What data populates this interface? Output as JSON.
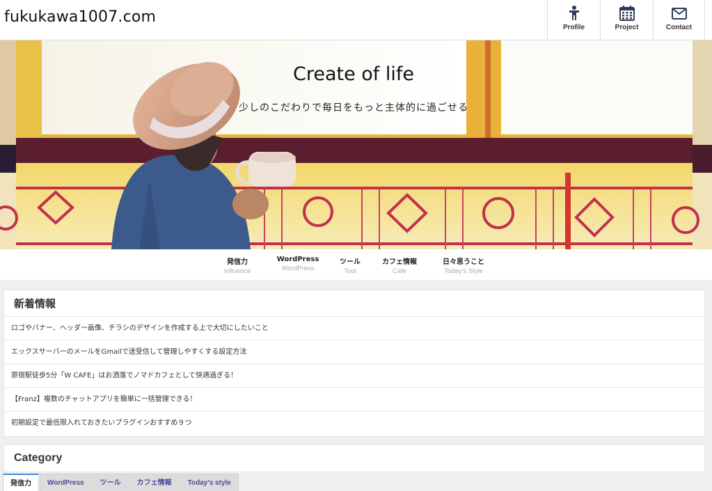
{
  "header": {
    "site_title": "fukukawa1007.com",
    "nav": [
      {
        "label": "Profile",
        "icon": "person-icon"
      },
      {
        "label": "Project",
        "icon": "calendar-icon"
      },
      {
        "label": "Contact",
        "icon": "envelope-icon"
      }
    ]
  },
  "hero": {
    "title": "Create of life",
    "subtitle": "少しのこだわりで毎日をもっと主体的に過ごせる"
  },
  "categories": [
    {
      "jp": "発信力",
      "en": "Influence"
    },
    {
      "jp": "WordPress",
      "en": "WordPress"
    },
    {
      "jp": "ツール",
      "en": "Tool"
    },
    {
      "jp": "カフェ情報",
      "en": "Cafe"
    },
    {
      "jp": "日々思うこと",
      "en": "Today's Style"
    }
  ],
  "news": {
    "heading": "新着情報",
    "items": [
      "ロゴやバナー、ヘッダー画像、チラシのデザインを作成する上で大切にしたいこと",
      "エックスサーバーのメールをGmailで送受信して管理しやすくする設定方法",
      "原宿駅徒歩5分「W CAFE」はお洒落でノマドカフェとして快適過ぎる！",
      "【Franz】複数のチャットアプリを簡単に一括管理できる！",
      "初期設定で最低限入れておきたいプラグインおすすめ９つ"
    ]
  },
  "category_section": {
    "heading": "Category",
    "tabs": [
      "発信力",
      "WordPress",
      "ツール",
      "カフェ情報",
      "Today's style"
    ]
  }
}
